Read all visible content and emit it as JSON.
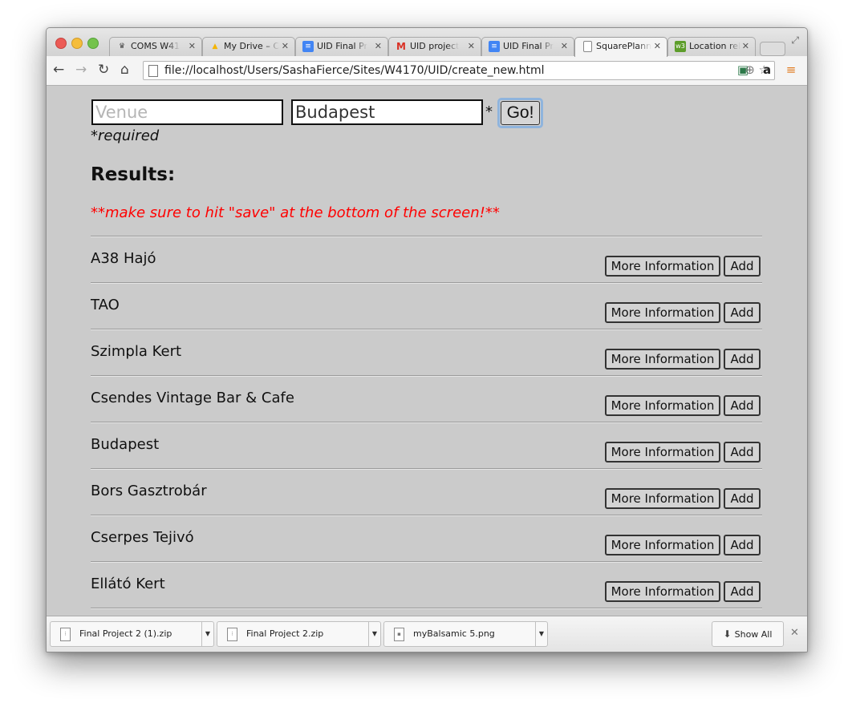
{
  "browser": {
    "tabs": [
      {
        "label": "COMS W41",
        "icon": "crown-icon",
        "color": "#444444",
        "glyph": "♛"
      },
      {
        "label": "My Drive – C",
        "icon": "drive-icon",
        "color": "#f4b400",
        "glyph": "▲"
      },
      {
        "label": "UID Final Pr",
        "icon": "docs-icon",
        "color": "#4285f4",
        "glyph": "≡"
      },
      {
        "label": "UID project",
        "icon": "gmail-icon",
        "color": "#d93025",
        "glyph": "M"
      },
      {
        "label": "UID Final Pr",
        "icon": "docs-icon",
        "color": "#4285f4",
        "glyph": "≡"
      },
      {
        "label": "SquarePlann",
        "icon": "page-icon",
        "color": "#ffffff",
        "glyph": ""
      },
      {
        "label": "Location rel",
        "icon": "w3-icon",
        "color": "#5d9d2a",
        "glyph": "w3"
      }
    ],
    "url": "file://localhost/Users/SashaFierce/Sites/W4170/UID/create_new.html"
  },
  "search": {
    "venue_placeholder": "Venue",
    "city_value": "Budapest",
    "asterisk": "*",
    "go_label": "Go!",
    "required_note": "*required"
  },
  "results": {
    "heading": "Results:",
    "warning": "**make sure to hit \"save\" at the bottom of the screen!**",
    "more_label": "More Information",
    "add_label": "Add",
    "items": [
      "A38 Hajó",
      "TAO",
      "Szimpla Kert",
      "Csendes Vintage Bar & Cafe",
      "Budapest",
      "Bors Gasztrobár",
      "Cserpes Tejivó",
      "Ellátó Kert"
    ]
  },
  "downloads": {
    "items": [
      "Final Project 2 (1).zip",
      "Final Project 2.zip",
      "myBalsamic 5.png"
    ],
    "show_all_label": "Show All"
  }
}
